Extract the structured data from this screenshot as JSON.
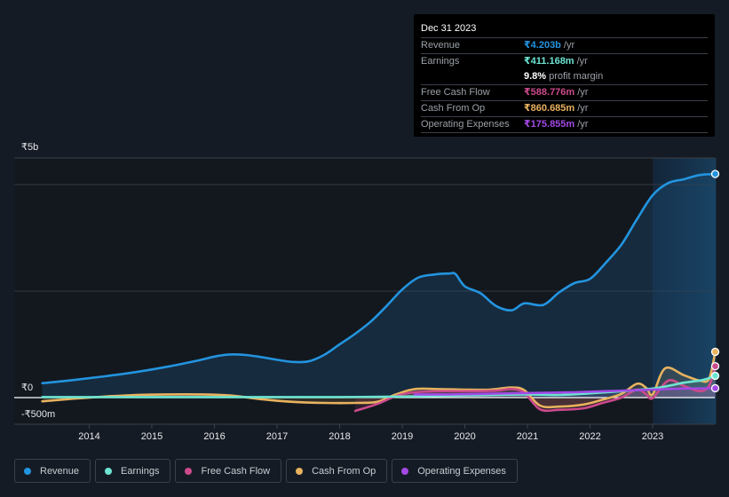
{
  "tooltip": {
    "date": "Dec 31 2023",
    "rows": [
      {
        "label": "Revenue",
        "value": "₹4.203b",
        "unit": "/yr",
        "color": "#2394df"
      },
      {
        "label": "Earnings",
        "value": "₹411.168m",
        "unit": "/yr",
        "color": "#6ce5d2"
      },
      {
        "label": "",
        "value": "9.8%",
        "unit": "profit margin",
        "color": "#ffffff"
      },
      {
        "label": "Free Cash Flow",
        "value": "₹588.776m",
        "unit": "/yr",
        "color": "#cc4a8c"
      },
      {
        "label": "Cash From Op",
        "value": "₹860.685m",
        "unit": "/yr",
        "color": "#e8b25f"
      },
      {
        "label": "Operating Expenses",
        "value": "₹175.855m",
        "unit": "/yr",
        "color": "#a349e6"
      }
    ]
  },
  "legend": [
    {
      "label": "Revenue",
      "color": "#2394df"
    },
    {
      "label": "Earnings",
      "color": "#6ce5d2"
    },
    {
      "label": "Free Cash Flow",
      "color": "#cc4a8c"
    },
    {
      "label": "Cash From Op",
      "color": "#e8b25f"
    },
    {
      "label": "Operating Expenses",
      "color": "#a349e6"
    }
  ],
  "chart_data": {
    "type": "line",
    "title": "",
    "xlabel": "",
    "ylabel": "",
    "currency": "₹",
    "y_tick_labels": [
      "₹5b",
      "₹0",
      "-₹500m"
    ],
    "y_gridlines_b": [
      2,
      4
    ],
    "ylim_b": [
      -0.5,
      4.5
    ],
    "xlim": [
      2013.25,
      2024.0
    ],
    "x_ticks": [
      "2014",
      "2015",
      "2016",
      "2017",
      "2018",
      "2019",
      "2020",
      "2021",
      "2022",
      "2023"
    ],
    "highlight_from": 2023.0,
    "grid": true,
    "legend_position": "bottom-left",
    "series": [
      {
        "name": "Revenue",
        "color": "#2394df",
        "fill": true,
        "points": [
          [
            2013.25,
            0.27
          ],
          [
            2013.75,
            0.33
          ],
          [
            2014.25,
            0.4
          ],
          [
            2014.75,
            0.48
          ],
          [
            2015.25,
            0.58
          ],
          [
            2015.75,
            0.7
          ],
          [
            2016.0,
            0.77
          ],
          [
            2016.25,
            0.81
          ],
          [
            2016.5,
            0.8
          ],
          [
            2016.75,
            0.76
          ],
          [
            2017.0,
            0.71
          ],
          [
            2017.25,
            0.67
          ],
          [
            2017.5,
            0.68
          ],
          [
            2017.75,
            0.8
          ],
          [
            2018.0,
            1.0
          ],
          [
            2018.25,
            1.2
          ],
          [
            2018.5,
            1.43
          ],
          [
            2018.75,
            1.72
          ],
          [
            2019.0,
            2.03
          ],
          [
            2019.25,
            2.25
          ],
          [
            2019.5,
            2.31
          ],
          [
            2019.75,
            2.33
          ],
          [
            2019.85,
            2.32
          ],
          [
            2020.0,
            2.09
          ],
          [
            2020.25,
            1.96
          ],
          [
            2020.5,
            1.72
          ],
          [
            2020.75,
            1.64
          ],
          [
            2020.95,
            1.77
          ],
          [
            2021.25,
            1.74
          ],
          [
            2021.5,
            1.97
          ],
          [
            2021.75,
            2.15
          ],
          [
            2022.0,
            2.23
          ],
          [
            2022.25,
            2.53
          ],
          [
            2022.5,
            2.87
          ],
          [
            2022.75,
            3.35
          ],
          [
            2023.0,
            3.8
          ],
          [
            2023.25,
            4.03
          ],
          [
            2023.5,
            4.1
          ],
          [
            2023.75,
            4.18
          ],
          [
            2024.0,
            4.2
          ]
        ]
      },
      {
        "name": "Operating Expenses",
        "color": "#a349e6",
        "fill": true,
        "points": [
          [
            2019.2,
            0.06
          ],
          [
            2019.75,
            0.06
          ],
          [
            2020.25,
            0.07
          ],
          [
            2020.75,
            0.08
          ],
          [
            2021.25,
            0.09
          ],
          [
            2021.75,
            0.1
          ],
          [
            2022.25,
            0.12
          ],
          [
            2022.75,
            0.14
          ],
          [
            2023.0,
            0.15
          ],
          [
            2023.5,
            0.17
          ],
          [
            2024.0,
            0.176
          ]
        ]
      },
      {
        "name": "Earnings",
        "color": "#6ce5d2",
        "fill": true,
        "points": [
          [
            2013.25,
            0.01
          ],
          [
            2014.0,
            0.01
          ],
          [
            2015.0,
            0.01
          ],
          [
            2016.0,
            0.01
          ],
          [
            2017.0,
            0.01
          ],
          [
            2018.0,
            0.01
          ],
          [
            2019.0,
            0.02
          ],
          [
            2019.5,
            0.03
          ],
          [
            2020.0,
            0.04
          ],
          [
            2020.5,
            0.05
          ],
          [
            2021.0,
            0.06
          ],
          [
            2021.5,
            0.05
          ],
          [
            2022.0,
            0.08
          ],
          [
            2022.5,
            0.12
          ],
          [
            2023.0,
            0.17
          ],
          [
            2023.25,
            0.22
          ],
          [
            2023.5,
            0.28
          ],
          [
            2023.8,
            0.33
          ],
          [
            2024.0,
            0.41
          ]
        ]
      },
      {
        "name": "Free Cash Flow",
        "color": "#cc4a8c",
        "fill": true,
        "points": [
          [
            2018.25,
            -0.25
          ],
          [
            2018.6,
            -0.12
          ],
          [
            2018.9,
            0.03
          ],
          [
            2019.2,
            0.1
          ],
          [
            2019.6,
            0.12
          ],
          [
            2020.0,
            0.12
          ],
          [
            2020.5,
            0.13
          ],
          [
            2020.75,
            0.16
          ],
          [
            2020.95,
            0.09
          ],
          [
            2021.2,
            -0.22
          ],
          [
            2021.5,
            -0.23
          ],
          [
            2021.9,
            -0.2
          ],
          [
            2022.2,
            -0.1
          ],
          [
            2022.5,
            0.0
          ],
          [
            2022.75,
            0.15
          ],
          [
            2022.9,
            0.06
          ],
          [
            2023.0,
            -0.01
          ],
          [
            2023.25,
            0.32
          ],
          [
            2023.5,
            0.22
          ],
          [
            2023.75,
            0.12
          ],
          [
            2023.9,
            0.22
          ],
          [
            2024.0,
            0.59
          ]
        ]
      },
      {
        "name": "Cash From Op",
        "color": "#e8b25f",
        "fill": true,
        "points": [
          [
            2013.25,
            -0.07
          ],
          [
            2013.75,
            -0.02
          ],
          [
            2014.25,
            0.02
          ],
          [
            2014.75,
            0.05
          ],
          [
            2015.25,
            0.06
          ],
          [
            2015.75,
            0.06
          ],
          [
            2016.25,
            0.04
          ],
          [
            2016.75,
            -0.03
          ],
          [
            2017.25,
            -0.08
          ],
          [
            2017.75,
            -0.1
          ],
          [
            2018.25,
            -0.1
          ],
          [
            2018.6,
            -0.08
          ],
          [
            2018.9,
            0.06
          ],
          [
            2019.2,
            0.16
          ],
          [
            2019.6,
            0.16
          ],
          [
            2020.0,
            0.15
          ],
          [
            2020.4,
            0.15
          ],
          [
            2020.75,
            0.19
          ],
          [
            2020.95,
            0.14
          ],
          [
            2021.2,
            -0.15
          ],
          [
            2021.5,
            -0.17
          ],
          [
            2021.9,
            -0.13
          ],
          [
            2022.2,
            -0.04
          ],
          [
            2022.5,
            0.07
          ],
          [
            2022.75,
            0.26
          ],
          [
            2022.9,
            0.18
          ],
          [
            2023.0,
            0.06
          ],
          [
            2023.2,
            0.55
          ],
          [
            2023.5,
            0.42
          ],
          [
            2023.75,
            0.32
          ],
          [
            2023.9,
            0.35
          ],
          [
            2024.0,
            0.86
          ]
        ]
      }
    ]
  }
}
